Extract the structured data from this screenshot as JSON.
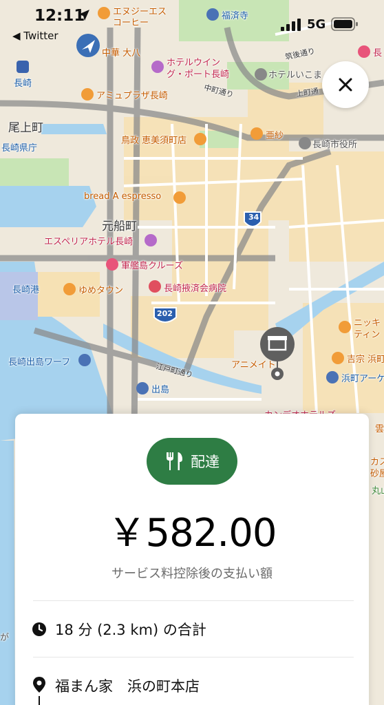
{
  "status_bar": {
    "time": "12:11",
    "back_label": "◀ Twitter",
    "network": "5G"
  },
  "map": {
    "labels": {
      "ebisu_coffee_1": "エヌジーエス",
      "ebisu_coffee_2": "コーヒー",
      "fukusaiji": "福済寺",
      "chuka_daihachi": "中華 大八",
      "hotel_wing_1": "ホテルウイン",
      "hotel_wing_2": "グ・ポート長崎",
      "hotel_ikoma": "ホテルいこま",
      "tsukuba_dori": "筑後通り",
      "nagasaki_station": "長崎",
      "amu_plaza": "アミュプラザ長崎",
      "nakamachi_dori": "中町通り",
      "kamimachi_dori": "上町通",
      "onoue_machi": "尾上町",
      "torimasa": "鳥政 恵美須町店",
      "amiya": "亜紗",
      "city_hall": "長崎市役所",
      "pref_office": "長崎県庁",
      "bread_espresso": "bread A espresso",
      "route_34": "34",
      "motofuna_machi": "元船町",
      "hotel_esperia": "エスペリアホテル長崎",
      "gunkanjima": "軍艦島クルーズ",
      "nagasaki_port": "長崎港",
      "youme_town": "ゆめタウン",
      "saiseikai": "長崎掖済会病院",
      "route_202": "202",
      "dejima_wharf": "長崎出島ワーフ",
      "edomachi_dori": "江戸町通り",
      "animate": "アニメイト",
      "dejima": "出島",
      "yoshiya": "吉宗 浜町",
      "hamamachi_arcade": "浜町アーケ",
      "nikki_1": "ニッキ",
      "nikki_2": "ティン",
      "canal_hotel": "カンデオホテルズ",
      "nagasaki_right": "長",
      "kasu_1": "カス",
      "kasu_2": "砂屋",
      "maru": "丸山",
      "kumo": "雲",
      "partial_left": "が"
    }
  },
  "card": {
    "badge_label": "配達",
    "amount": "￥582.00",
    "subtitle": "サービス料控除後の支払い額",
    "duration": "18 分 (2.3 km) の合計",
    "store": "福まん家　浜の町本店"
  },
  "colors": {
    "accent_green": "#2e7d44",
    "water": "#a7d3ee",
    "park": "#c9e6b7",
    "building": "#f7e2b6"
  }
}
